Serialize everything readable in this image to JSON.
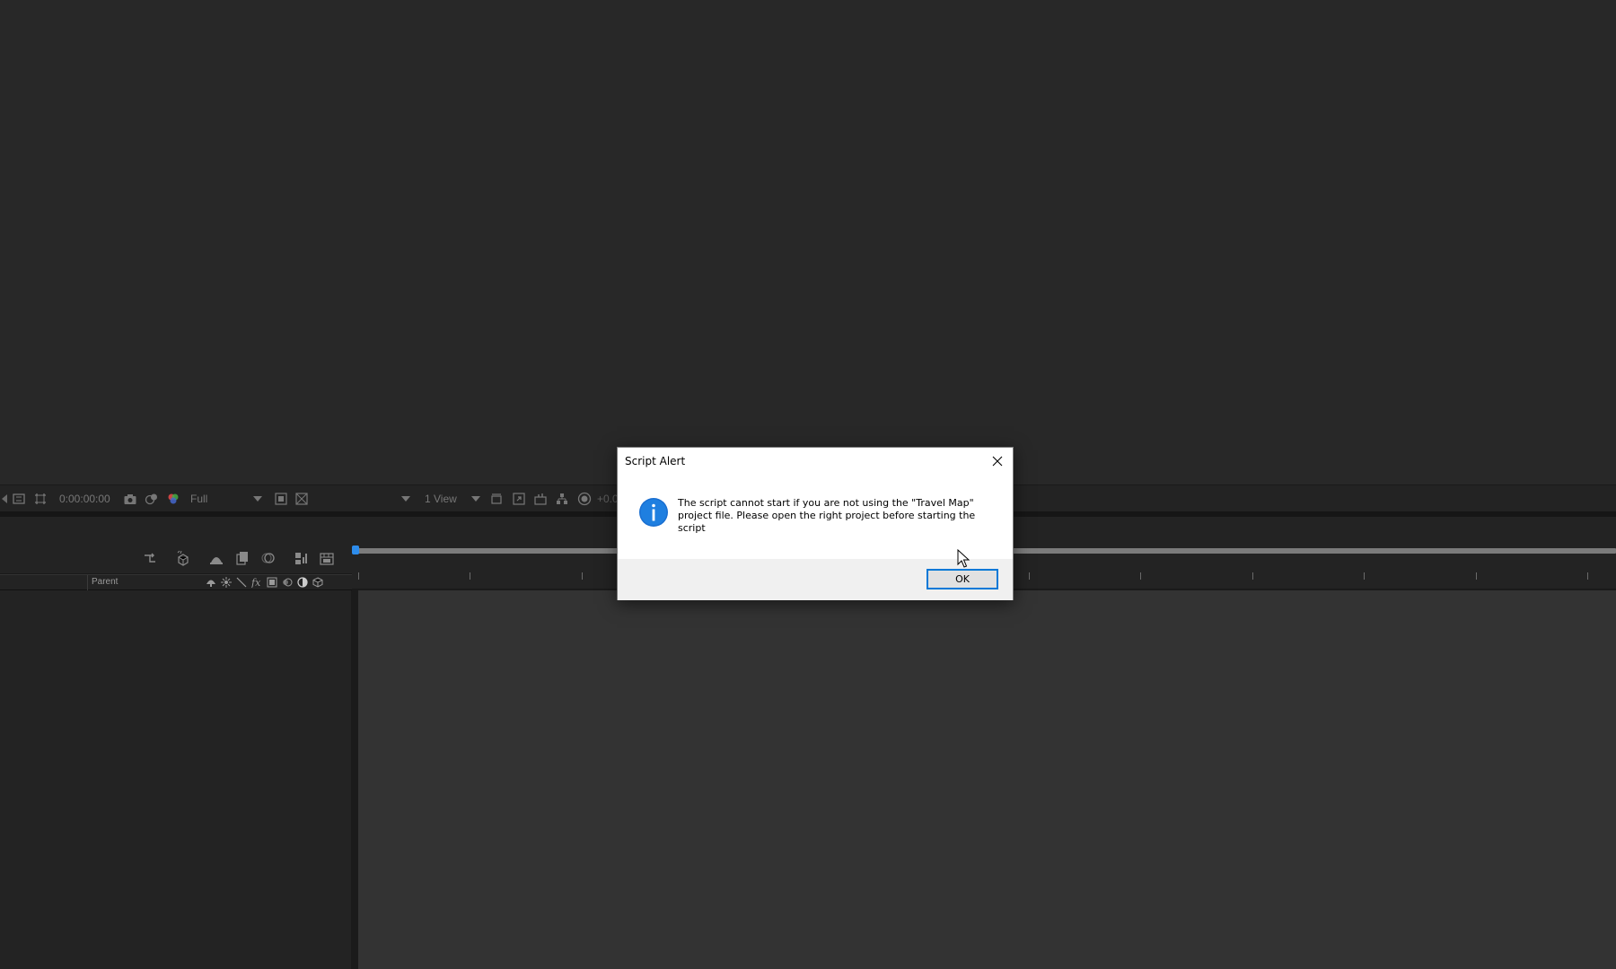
{
  "viewer_toolbar": {
    "timecode": "0:00:00:00",
    "resolution": "Full",
    "view_layout": "1 View",
    "exposure": "+0.0"
  },
  "layer_columns": {
    "parent_label": "Parent"
  },
  "dialog": {
    "title": "Script Alert",
    "message": "The script cannot start if you are not using the \"Travel Map\" project file. Please open the right project before starting the script",
    "ok_label": "OK",
    "icon": "info-icon",
    "accent_color": "#0078d7"
  },
  "icons": {
    "viewer_toolbar": [
      "region-of-interest-icon",
      "transparency-grid-icon",
      "snapshot-camera-icon",
      "show-snapshot-icon",
      "color-channels-icon",
      "toggle-transparency-icon",
      "fast-previews-icon",
      "reset-exposure-icon"
    ],
    "timeline_tools": [
      "composition-flowchart-icon",
      "draft-3d-icon",
      "hide-shy-layers-icon",
      "frame-blending-icon",
      "motion-blur-icon",
      "graph-editor-icon",
      "comp-settings-icon"
    ]
  }
}
